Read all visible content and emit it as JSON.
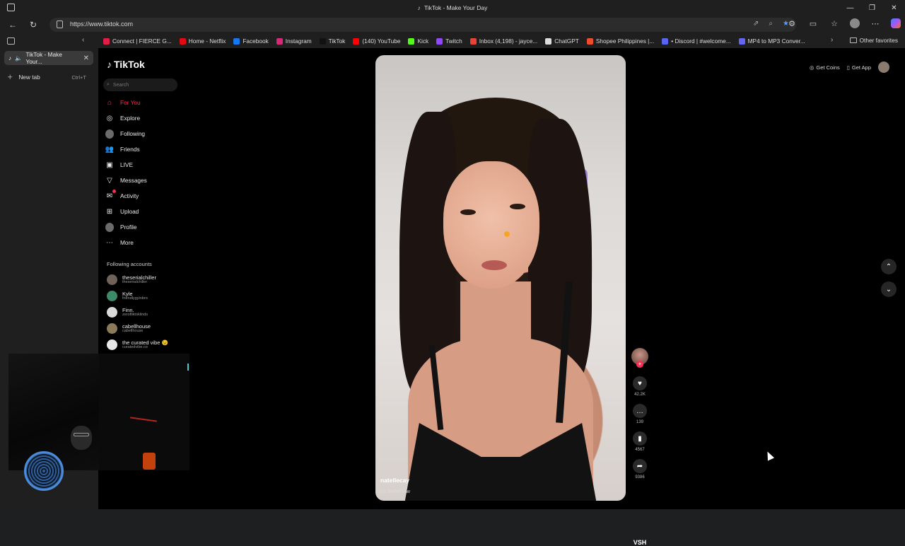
{
  "window": {
    "title": "TikTok - Make Your Day",
    "controls": [
      "—",
      "❐",
      "✕"
    ]
  },
  "addressbar": {
    "url": "https://www.tiktok.com"
  },
  "bookmarks": [
    {
      "label": "Connect | FIERCE G...",
      "color": "#e11d48"
    },
    {
      "label": "Home - Netflix",
      "color": "#e50914"
    },
    {
      "label": "Facebook",
      "color": "#1877f2"
    },
    {
      "label": "Instagram",
      "color": "#d62976"
    },
    {
      "label": "TikTok",
      "color": "#111111"
    },
    {
      "label": "(140) YouTube",
      "color": "#ff0000"
    },
    {
      "label": "Kick",
      "color": "#53fc18"
    },
    {
      "label": "Twitch",
      "color": "#9146ff"
    },
    {
      "label": "Inbox (4,198) - jayce...",
      "color": "#ea4335"
    },
    {
      "label": "ChatGPT",
      "color": "#dddddd"
    },
    {
      "label": "Shopee Philippines |...",
      "color": "#ee4d2d"
    },
    {
      "label": "• Discord | #welcome...",
      "color": "#5865f2"
    },
    {
      "label": "MP4 to MP3 Conver...",
      "color": "#6366f1"
    }
  ],
  "bookmarks_other": "Other favorites",
  "tabs": {
    "active": "TikTok - Make Your...",
    "new_tab": "New tab",
    "new_tab_shortcut": "Ctrl+T"
  },
  "tiktok": {
    "logo": "TikTok",
    "search_placeholder": "Search",
    "nav": [
      {
        "label": "For You",
        "icon": "home-icon"
      },
      {
        "label": "Explore",
        "icon": "compass-icon"
      },
      {
        "label": "Following",
        "icon": "following-icon"
      },
      {
        "label": "Friends",
        "icon": "friends-icon"
      },
      {
        "label": "LIVE",
        "icon": "live-icon"
      },
      {
        "label": "Messages",
        "icon": "messages-icon"
      },
      {
        "label": "Activity",
        "icon": "activity-icon"
      },
      {
        "label": "Upload",
        "icon": "upload-icon"
      },
      {
        "label": "Profile",
        "icon": "profile-icon"
      },
      {
        "label": "More",
        "icon": "more-icon"
      }
    ],
    "following_title": "Following accounts",
    "following": [
      {
        "name": "theserialchiller",
        "handle": "theserialchiller"
      },
      {
        "name": "Kyle",
        "handle": "friendlygyinbro"
      },
      {
        "name": "Finn.",
        "handle": "zerofliktoklinds"
      },
      {
        "name": "cabellhouse",
        "handle": "cabellhouse"
      },
      {
        "name": "the curated vibe 😉",
        "handle": "curatedvibe.co"
      }
    ],
    "topright": {
      "coins": "Get Coins",
      "app": "Get App"
    },
    "video": {
      "username": "natellecay",
      "caption": "lss hwhehhw"
    },
    "actions": {
      "likes": "42.2K",
      "comments": "139",
      "saves": "4567",
      "shares": "9386",
      "music": "VSH"
    }
  }
}
